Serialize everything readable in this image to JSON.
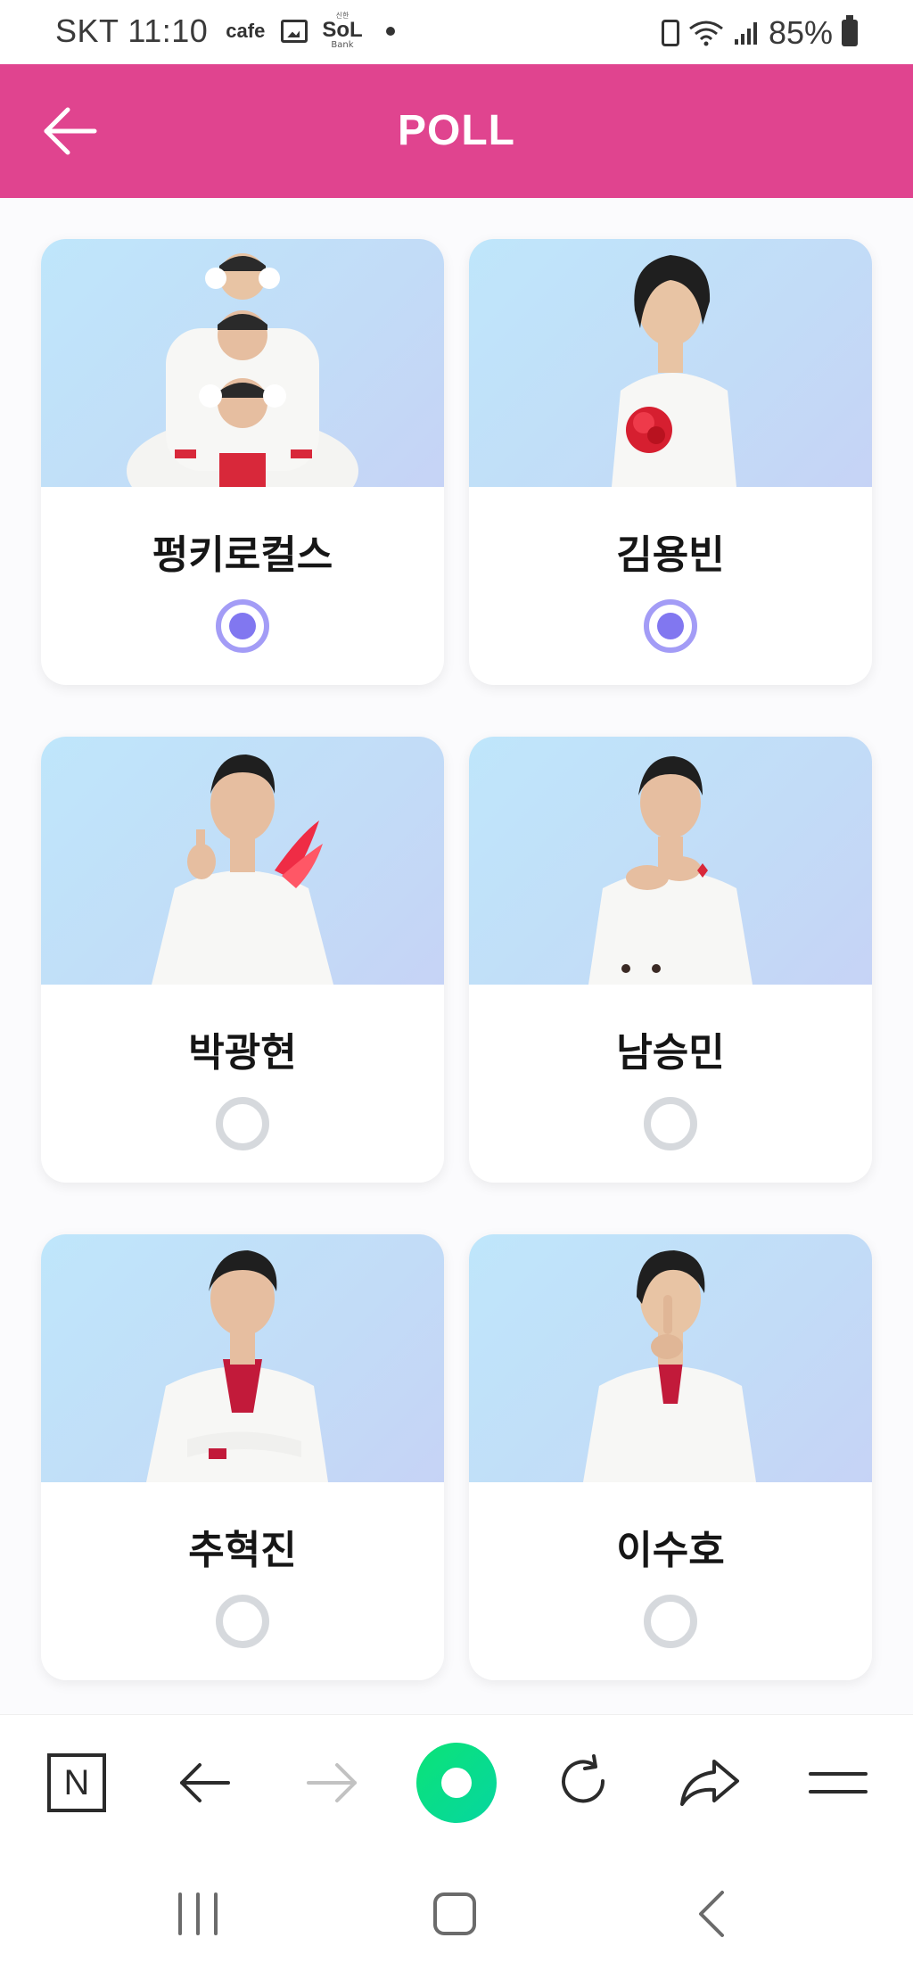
{
  "status_bar": {
    "carrier_time": "SKT 11:10",
    "cafe_label": "cafe",
    "sol_top": "신한",
    "sol_main": "SoL",
    "sol_bottom": "Bank",
    "battery_percent": "85%"
  },
  "header": {
    "title": "POLL",
    "back_icon": "arrow-left-icon",
    "background": "#e0448f"
  },
  "poll": {
    "selected_color": "#8177f0",
    "options": [
      {
        "name": "펑키로컬스",
        "selected": true
      },
      {
        "name": "김용빈",
        "selected": true
      },
      {
        "name": "박광현",
        "selected": false
      },
      {
        "name": "남승민",
        "selected": false
      },
      {
        "name": "추혁진",
        "selected": false
      },
      {
        "name": "이수호",
        "selected": false
      }
    ]
  },
  "toolbar": {
    "n_label": "N",
    "items": [
      "naver-home-icon",
      "back-icon",
      "forward-icon",
      "green-dot-icon",
      "refresh-icon",
      "share-icon",
      "menu-icon"
    ]
  },
  "nav_bar": {
    "items": [
      "recent-apps-icon",
      "home-icon",
      "back-icon"
    ]
  }
}
